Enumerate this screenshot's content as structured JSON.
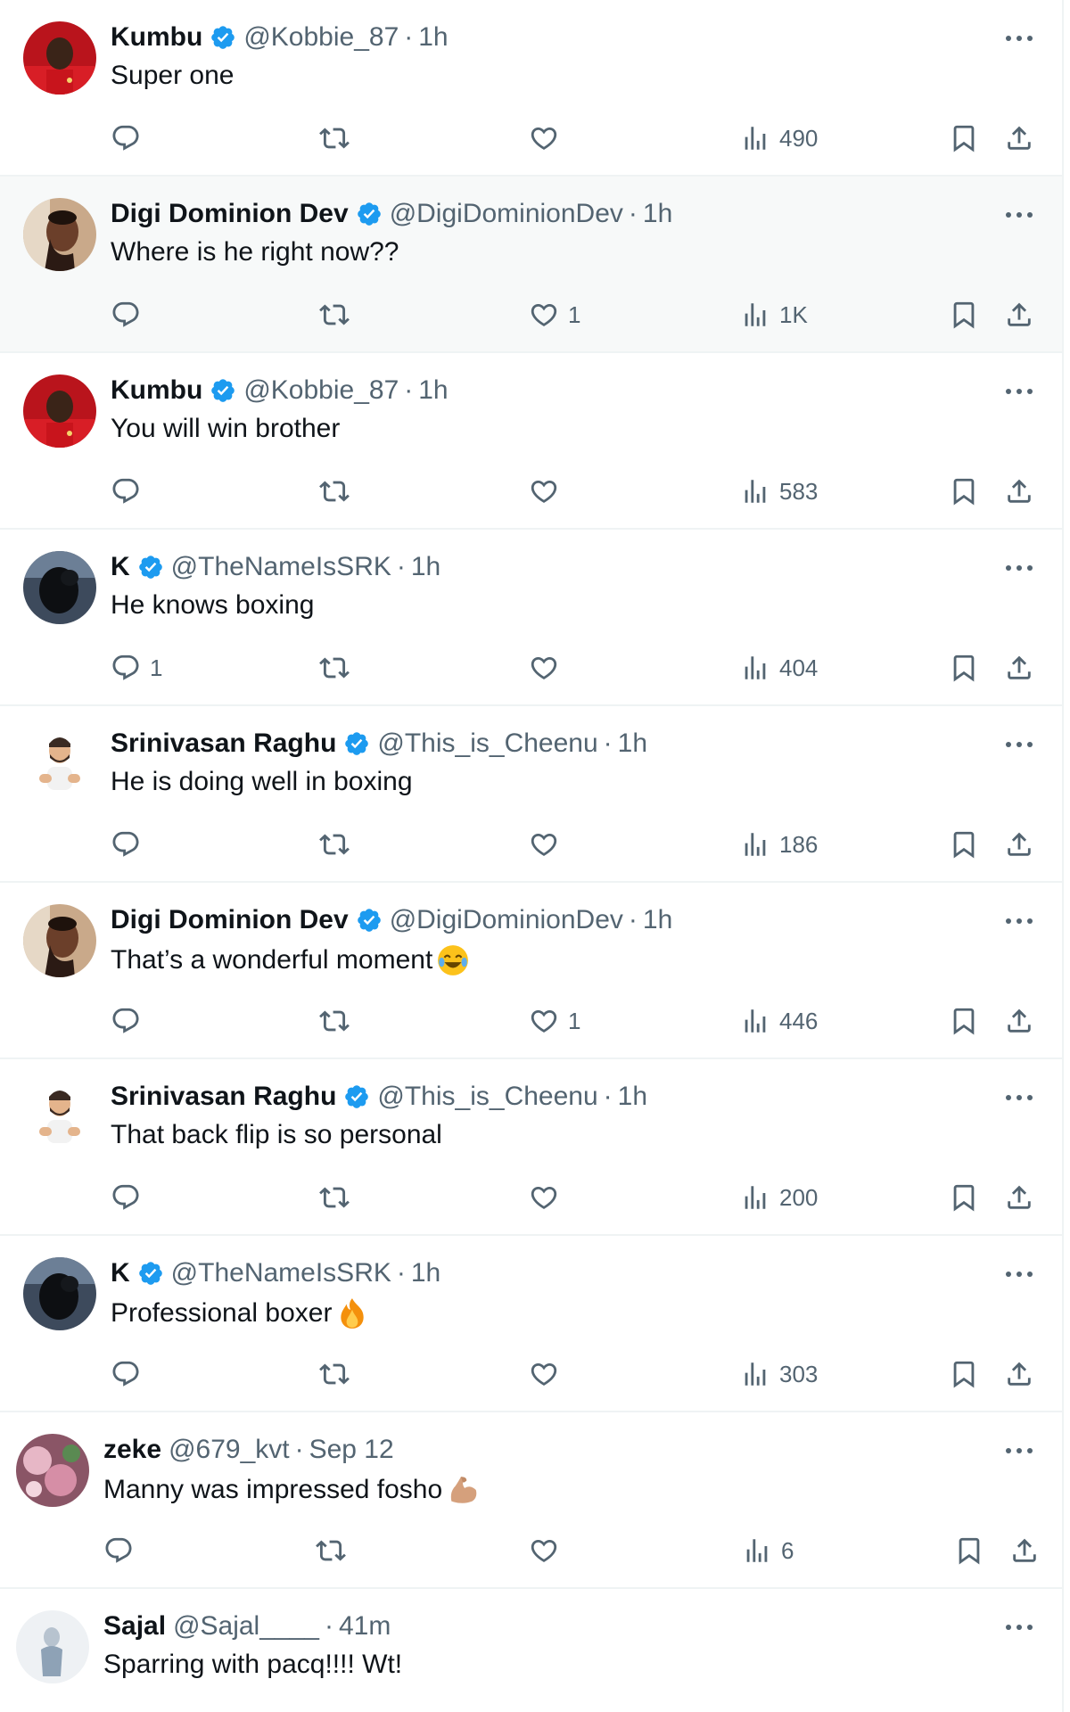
{
  "posts": [
    {
      "name": "Kumbu",
      "verified": true,
      "handle": "@Kobbie_87",
      "time": "1h",
      "text": "Super one",
      "emoji": "",
      "replies": "",
      "likes": "",
      "views": "490",
      "avatar": "red-jersey-player",
      "highlighted": false
    },
    {
      "name": "Digi Dominion Dev",
      "verified": true,
      "handle": "@DigiDominionDev",
      "time": "1h",
      "text": "Where is he right now??",
      "emoji": "",
      "replies": "",
      "likes": "1",
      "views": "1K",
      "avatar": "man-thinking-photo",
      "highlighted": true
    },
    {
      "name": "Kumbu",
      "verified": true,
      "handle": "@Kobbie_87",
      "time": "1h",
      "text": "You will win brother",
      "emoji": "",
      "replies": "",
      "likes": "",
      "views": "583",
      "avatar": "red-jersey-player",
      "highlighted": false
    },
    {
      "name": "K",
      "verified": true,
      "handle": "@TheNameIsSRK",
      "time": "1h",
      "text": "He knows boxing",
      "emoji": "",
      "replies": "1",
      "likes": "",
      "views": "404",
      "avatar": "dark-silhouette-photo",
      "highlighted": false
    },
    {
      "name": "Srinivasan Raghu",
      "verified": true,
      "handle": "@This_is_Cheenu",
      "time": "1h",
      "text": "He is doing well in boxing",
      "emoji": "",
      "replies": "",
      "likes": "",
      "views": "186",
      "avatar": "memoji-bearded-man",
      "highlighted": false
    },
    {
      "name": "Digi Dominion Dev",
      "verified": true,
      "handle": "@DigiDominionDev",
      "time": "1h",
      "text": "That’s a wonderful moment",
      "emoji": "tears-of-joy",
      "replies": "",
      "likes": "1",
      "views": "446",
      "avatar": "man-thinking-photo",
      "highlighted": false
    },
    {
      "name": "Srinivasan Raghu",
      "verified": true,
      "handle": "@This_is_Cheenu",
      "time": "1h",
      "text": "That back flip is so personal",
      "emoji": "",
      "replies": "",
      "likes": "",
      "views": "200",
      "avatar": "memoji-bearded-man",
      "highlighted": false
    },
    {
      "name": "K",
      "verified": true,
      "handle": "@TheNameIsSRK",
      "time": "1h",
      "text": "Professional boxer",
      "emoji": "fire",
      "replies": "",
      "likes": "",
      "views": "303",
      "avatar": "dark-silhouette-photo",
      "highlighted": false
    },
    {
      "name": "zeke",
      "verified": false,
      "handle": "@679_kvt",
      "time": "Sep 12",
      "text": "Manny was impressed fosho",
      "emoji": "flexed-biceps",
      "replies": "",
      "likes": "",
      "views": "6",
      "avatar": "pink-floral-photo",
      "highlighted": false
    },
    {
      "name": "Sajal",
      "verified": false,
      "handle": "@Sajal____",
      "time": "41m",
      "text": "Sparring with pacq!!!! Wt!",
      "emoji": "",
      "replies": "",
      "likes": "",
      "views": "",
      "avatar": "pale-blue-figure-photo",
      "highlighted": false
    }
  ],
  "colors": {
    "text": "#0f1419",
    "secondary": "#536471",
    "verified": "#1d9bf0",
    "divider": "#eff3f4",
    "highlight_bg": "#f7f9f9"
  },
  "icons": {
    "reply": "reply-icon",
    "repost": "repost-icon",
    "like": "heart-icon",
    "views": "views-icon",
    "bookmark": "bookmark-icon",
    "share": "share-icon",
    "more": "more-icon",
    "verified": "verified-badge-icon"
  }
}
